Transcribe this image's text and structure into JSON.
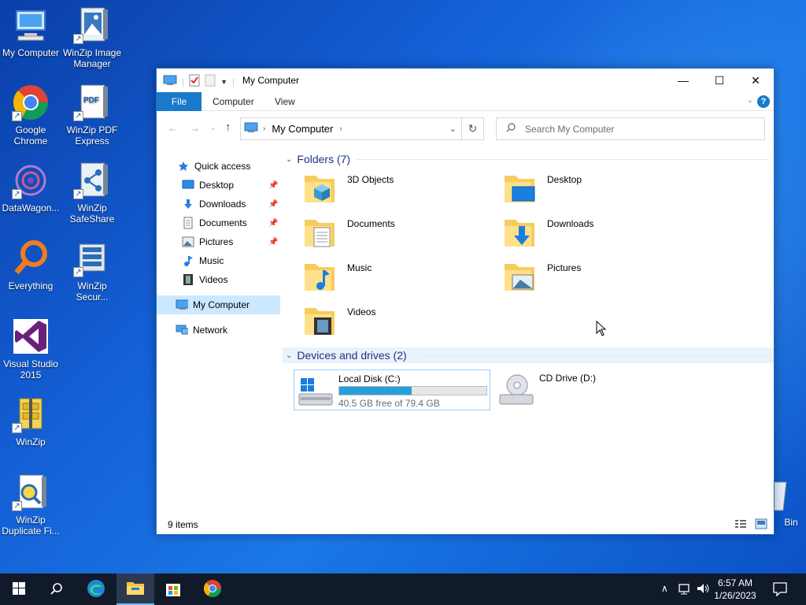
{
  "desktop": {
    "icons": [
      {
        "label": "My Computer",
        "icon": "my-computer-icon"
      },
      {
        "label": "WinZip Image Manager",
        "icon": "winzip-image-manager-icon"
      },
      {
        "label": "Google Chrome",
        "icon": "chrome-icon"
      },
      {
        "label": "WinZip PDF Express",
        "icon": "winzip-pdf-icon"
      },
      {
        "label": "DataWagon...",
        "icon": "datawagon-icon"
      },
      {
        "label": "WinZip SafeShare",
        "icon": "winzip-safeshare-icon"
      },
      {
        "label": "Everything",
        "icon": "everything-icon"
      },
      {
        "label": "WinZip Secur...",
        "icon": "winzip-secure-icon"
      },
      {
        "label": "Visual Studio 2015",
        "icon": "visual-studio-icon"
      },
      {
        "label": "WinZip",
        "icon": "winzip-icon"
      },
      {
        "label": "WinZip Duplicate Fi...",
        "icon": "winzip-duplicate-icon"
      },
      {
        "label": "Bin",
        "icon": "recycle-bin-icon"
      }
    ]
  },
  "window": {
    "title": "My Computer",
    "controls": {
      "minimize": "—",
      "maximize": "☐",
      "close": "✕"
    },
    "ribbon_tabs": [
      "File",
      "Computer",
      "View"
    ],
    "address": {
      "location": "My Computer"
    },
    "search": {
      "placeholder": "Search My Computer"
    },
    "nav": {
      "quick_access": "Quick access",
      "pinned": [
        "Desktop",
        "Downloads",
        "Documents",
        "Pictures"
      ],
      "others": [
        "Music",
        "Videos"
      ],
      "my_computer": "My Computer",
      "network": "Network"
    },
    "folders_header": "Folders (7)",
    "folders": [
      "3D Objects",
      "Desktop",
      "Documents",
      "Downloads",
      "Music",
      "Pictures",
      "Videos"
    ],
    "devices_header": "Devices and drives (2)",
    "drives": [
      {
        "name": "Local Disk (C:)",
        "free": "40.5 GB free of 79.4 GB",
        "used_fraction": 0.49
      },
      {
        "name": "CD Drive (D:)"
      }
    ],
    "status": "9 items"
  },
  "taskbar": {
    "time": "6:57 AM",
    "date": "1/26/2023"
  }
}
